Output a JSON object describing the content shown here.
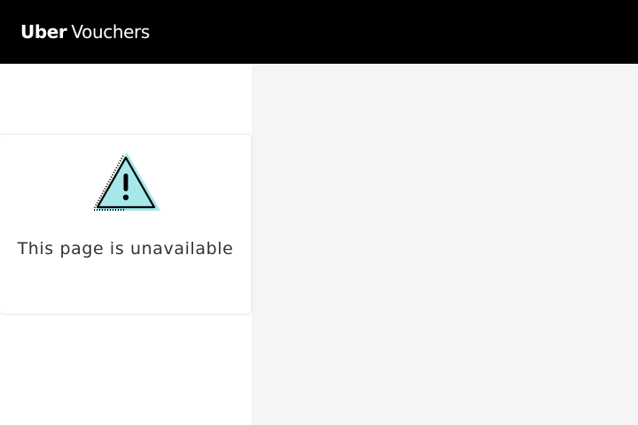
{
  "header": {
    "brand_name": "Uber",
    "brand_product": "Vouchers",
    "background": "#000000"
  },
  "error_card": {
    "icon": "warning-triangle-icon",
    "icon_accent": "#a6e7ea",
    "message": "This page is unavailable"
  },
  "colors": {
    "right_pane": "#f5f5f5",
    "text": "#333333"
  }
}
